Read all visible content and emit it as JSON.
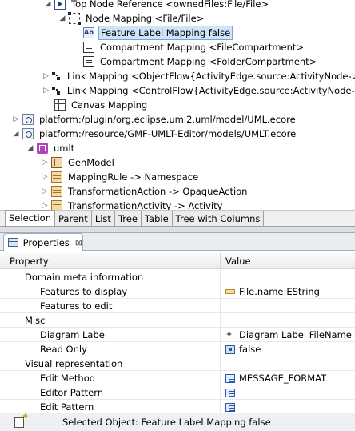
{
  "tree": {
    "rows": [
      {
        "label": "Top Node Reference <ownedFiles:File/File>",
        "icon": "top-node-reference-icon"
      },
      {
        "label": "Node Mapping <File/File>",
        "icon": "node-mapping-icon"
      },
      {
        "label": "Feature Label Mapping false",
        "icon": "feature-label-mapping-icon"
      },
      {
        "label": "Compartment Mapping <FileCompartment>",
        "icon": "compartment-mapping-icon"
      },
      {
        "label": "Compartment Mapping <FolderCompartment>",
        "icon": "compartment-mapping-icon"
      },
      {
        "label": "Link Mapping <ObjectFlow{ActivityEdge.source:ActivityNode->Act",
        "icon": "link-mapping-icon"
      },
      {
        "label": "Link Mapping <ControlFlow{ActivityEdge.source:ActivityNode->Ac",
        "icon": "link-mapping-icon"
      },
      {
        "label": "Canvas Mapping",
        "icon": "canvas-mapping-icon"
      },
      {
        "label": "platform:/plugin/org.eclipse.uml2.uml/model/UML.ecore",
        "icon": "ecore-resource-icon"
      },
      {
        "label": "platform:/resource/GMF-UMLT-Editor/models/UMLT.ecore",
        "icon": "ecore-resource-icon"
      },
      {
        "label": "umlt",
        "icon": "package-icon"
      },
      {
        "label": "GenModel",
        "icon": "genmodel-icon"
      },
      {
        "label": "MappingRule -> Namespace",
        "icon": "eclass-icon"
      },
      {
        "label": "TransformationAction -> OpaqueAction",
        "icon": "eclass-icon"
      },
      {
        "label": "TransformationActivity -> Activity",
        "icon": "eclass-icon"
      }
    ]
  },
  "tabs": [
    "Selection",
    "Parent",
    "List",
    "Tree",
    "Table",
    "Tree with Columns"
  ],
  "properties": {
    "title": "Properties",
    "columns": {
      "property": "Property",
      "value": "Value"
    },
    "rows": [
      {
        "property": "Domain meta information",
        "value": "",
        "icon": ""
      },
      {
        "property": "Features to display",
        "value": "File.name:EString",
        "icon": "estring-attribute-icon"
      },
      {
        "property": "Features to edit",
        "value": "",
        "icon": ""
      },
      {
        "property": "Misc",
        "value": "",
        "icon": ""
      },
      {
        "property": "Diagram Label",
        "value": "Diagram Label FileName",
        "icon": "diagram-label-icon"
      },
      {
        "property": "Read Only",
        "value": "false",
        "icon": "boolean-icon"
      },
      {
        "property": "Visual representation",
        "value": "",
        "icon": ""
      },
      {
        "property": "Edit Method",
        "value": "MESSAGE_FORMAT",
        "icon": "enum-literal-icon"
      },
      {
        "property": "Editor Pattern",
        "value": "",
        "icon": "enum-literal-icon"
      },
      {
        "property": "Edit Pattern",
        "value": "",
        "icon": "enum-literal-icon"
      }
    ]
  },
  "status": {
    "text": "Selected Object: Feature Label Mapping false"
  },
  "colors": {
    "selection": "#cfe3fb",
    "selection_border": "#7da2ce"
  }
}
